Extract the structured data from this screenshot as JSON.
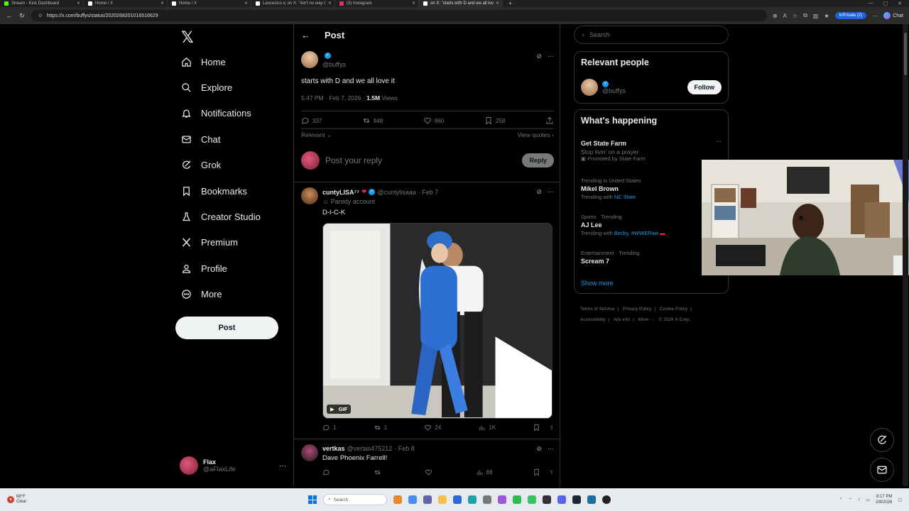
{
  "browser": {
    "tabs": [
      {
        "title": "Stream - Kick Dashboard",
        "color": "#53fc18"
      },
      {
        "title": "Home / X",
        "color": "#ffffff"
      },
      {
        "title": "Home / X",
        "color": "#ffffff"
      },
      {
        "title": "Lancesico ις on X: \"Ain't no way t",
        "color": "#ffffff"
      },
      {
        "title": "(3) Instagram",
        "color": "#e1306c"
      },
      {
        "title": "on X: \"starts with D and we all lov",
        "color": "#ffffff"
      }
    ],
    "url": "https://x.com/buffys/status/2020268201016516629",
    "inprivate": "InPrivate (2)",
    "chat_label": "Chat"
  },
  "nav": {
    "items": [
      {
        "label": "Home",
        "icon": "home-icon"
      },
      {
        "label": "Explore",
        "icon": "search-icon"
      },
      {
        "label": "Notifications",
        "icon": "bell-icon"
      },
      {
        "label": "Chat",
        "icon": "mail-icon"
      },
      {
        "label": "Grok",
        "icon": "grok-icon"
      },
      {
        "label": "Bookmarks",
        "icon": "bookmark-icon"
      },
      {
        "label": "Creator Studio",
        "icon": "flask-icon"
      },
      {
        "label": "Premium",
        "icon": "x-icon"
      },
      {
        "label": "Profile",
        "icon": "person-icon"
      },
      {
        "label": "More",
        "icon": "more-circle-icon"
      }
    ],
    "post_label": "Post",
    "me": {
      "name": "Flax",
      "handle": "@aFlaxLife"
    }
  },
  "main": {
    "header_title": "Post",
    "op": {
      "handle": "@buffys",
      "text": "starts with D and we all love it",
      "time": "5:47 PM · Feb 7, 2026 · ",
      "views": "1.5M",
      "views_label": " Views",
      "replies": "337",
      "reposts": "848",
      "likes": "860",
      "bookmarks": "258"
    },
    "sort_label": "Relevant",
    "view_quotes": "View quotes",
    "reply_placeholder": "Post your reply",
    "reply_button": "Reply",
    "replies": [
      {
        "name": "cuntyLISA⁷⁷",
        "handle": "@cuntylisaaa",
        "date": "· Feb 7",
        "sub": "Parody account",
        "text": "D-I-C-K",
        "gif_label": "GIF",
        "replies": "1",
        "reposts": "1",
        "likes": "24",
        "views": "1K"
      },
      {
        "name": "vertkas",
        "handle": "@vertas475212",
        "date": "· Feb 8",
        "text": "Dave Phoenix Farrell!",
        "replies": "",
        "reposts": "",
        "likes": "",
        "views": "88"
      }
    ]
  },
  "right": {
    "search_placeholder": "Search",
    "relevant_title": "Relevant people",
    "relevant_handle": "@buffys",
    "follow_label": "Follow",
    "happening_title": "What's happening",
    "trends": [
      {
        "cat": "",
        "name": "Get State Farm",
        "line": "Stop livin' on a prayer",
        "promo": "Promoted by State Farm"
      },
      {
        "cat": "Trending in United States",
        "name": "Mikel Brown",
        "prefix": "Trending with ",
        "link": "NC State"
      },
      {
        "cat": "Sports · Trending",
        "name": "AJ Lee",
        "prefix": "Trending with ",
        "link": "Becky, #WWERaw"
      },
      {
        "cat": "Entertainment · Trending",
        "name": "Scream 7"
      }
    ],
    "show_more": "Show more",
    "footer": [
      "Terms of Service",
      "|",
      "Privacy Policy",
      "|",
      "Cookie Policy",
      "|",
      "Accessibility",
      "|",
      "Ads info",
      "|",
      "More ···",
      "© 2026 X Corp."
    ]
  },
  "taskbar": {
    "temp": "68°F",
    "weather": "Clear",
    "search": "Search",
    "time": "8:17 PM",
    "date": "2/8/2026"
  },
  "colors": {
    "accent": "#1d9bf0",
    "border": "#2f3336",
    "muted": "#71767b"
  }
}
